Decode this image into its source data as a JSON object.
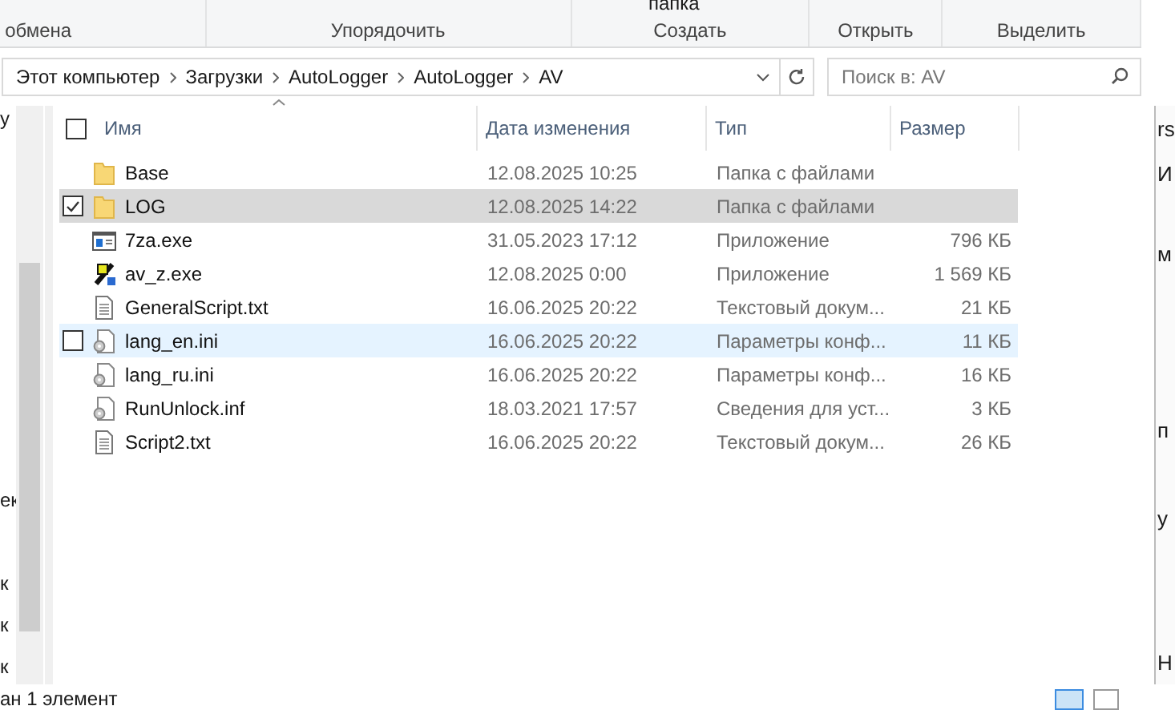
{
  "ribbon": {
    "top_fragments": [
      {
        "label": "папка"
      }
    ],
    "groups": [
      {
        "label": "обмена"
      },
      {
        "label": "Упорядочить"
      },
      {
        "label": "Создать"
      },
      {
        "label": "Открыть"
      },
      {
        "label": "Выделить"
      }
    ]
  },
  "address_bar": {
    "path": [
      "Этот компьютер",
      "Загрузки",
      "AutoLogger",
      "AutoLogger",
      "AV"
    ]
  },
  "search": {
    "placeholder": "Поиск в: AV"
  },
  "nav_pane": {
    "items": [
      {
        "label": "у"
      },
      {
        "label": "ек"
      },
      {
        "label": "к"
      },
      {
        "label": "к"
      },
      {
        "label": "к"
      }
    ]
  },
  "table": {
    "select_all": {
      "checked": false
    },
    "columns": [
      "Имя",
      "Дата изменения",
      "Тип",
      "Размер"
    ],
    "rows": [
      {
        "kind": "folder",
        "name": "Base",
        "date": "12.08.2025 10:25",
        "type": "Папка с файлами",
        "size": "",
        "selected": false,
        "hovered": false
      },
      {
        "kind": "folder",
        "name": "LOG",
        "date": "12.08.2025 14:22",
        "type": "Папка с файлами",
        "size": "",
        "selected": true,
        "hovered": false
      },
      {
        "kind": "app",
        "name": "7za.exe",
        "date": "31.05.2023 17:12",
        "type": "Приложение",
        "size": "796 КБ",
        "selected": false,
        "hovered": false
      },
      {
        "kind": "tool",
        "name": "av_z.exe",
        "date": "12.08.2025 0:00",
        "type": "Приложение",
        "size": "1 569 КБ",
        "selected": false,
        "hovered": false
      },
      {
        "kind": "text",
        "name": "GeneralScript.txt",
        "date": "16.06.2025 20:22",
        "type": "Текстовый докум...",
        "size": "21 КБ",
        "selected": false,
        "hovered": false
      },
      {
        "kind": "config",
        "name": "lang_en.ini",
        "date": "16.06.2025 20:22",
        "type": "Параметры конф...",
        "size": "11 КБ",
        "selected": false,
        "hovered": true
      },
      {
        "kind": "config",
        "name": "lang_ru.ini",
        "date": "16.06.2025 20:22",
        "type": "Параметры конф...",
        "size": "16 КБ",
        "selected": false,
        "hovered": false
      },
      {
        "kind": "config",
        "name": "RunUnlock.inf",
        "date": "18.03.2021 17:57",
        "type": "Сведения для уст...",
        "size": "3 КБ",
        "selected": false,
        "hovered": false
      },
      {
        "kind": "text",
        "name": "Script2.txt",
        "date": "16.06.2025 20:22",
        "type": "Текстовый докум...",
        "size": "26 КБ",
        "selected": false,
        "hovered": false
      }
    ]
  },
  "right_window": {
    "fragments": [
      {
        "label": "rs"
      },
      {
        "label": "И"
      },
      {
        "label": "м"
      },
      {
        "label": "п"
      },
      {
        "label": "у"
      },
      {
        "label": "Н"
      }
    ]
  },
  "status_bar": {
    "text": "ан 1 элемент"
  }
}
